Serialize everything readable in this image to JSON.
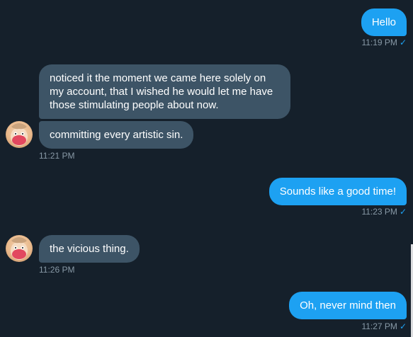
{
  "messages": [
    {
      "id": "m1",
      "direction": "outgoing",
      "text": "Hello",
      "time": "11:19 PM",
      "read_mark": "✓"
    },
    {
      "id": "m2",
      "direction": "incoming",
      "text": "noticed it the moment we came here solely on my account, that I wished he would let me have those stimulating people about now."
    },
    {
      "id": "m3",
      "direction": "incoming",
      "text": "committing every artistic sin.",
      "time": "11:21 PM"
    },
    {
      "id": "m4",
      "direction": "outgoing",
      "text": "Sounds like a good time!",
      "time": "11:23 PM",
      "read_mark": "✓"
    },
    {
      "id": "m5",
      "direction": "incoming",
      "text": "the vicious thing.",
      "time": "11:26 PM"
    },
    {
      "id": "m6",
      "direction": "outgoing",
      "text": "Oh, never mind then",
      "time": "11:27 PM",
      "read_mark": "✓"
    }
  ],
  "colors": {
    "background": "#15202b",
    "outgoing_bubble": "#1da1f2",
    "incoming_bubble": "#3d5466",
    "timestamp": "#8899a6",
    "read_mark": "#1da1f2"
  },
  "icons": {
    "avatar": "user-avatar-icon",
    "read_mark": "checkmark-icon"
  }
}
